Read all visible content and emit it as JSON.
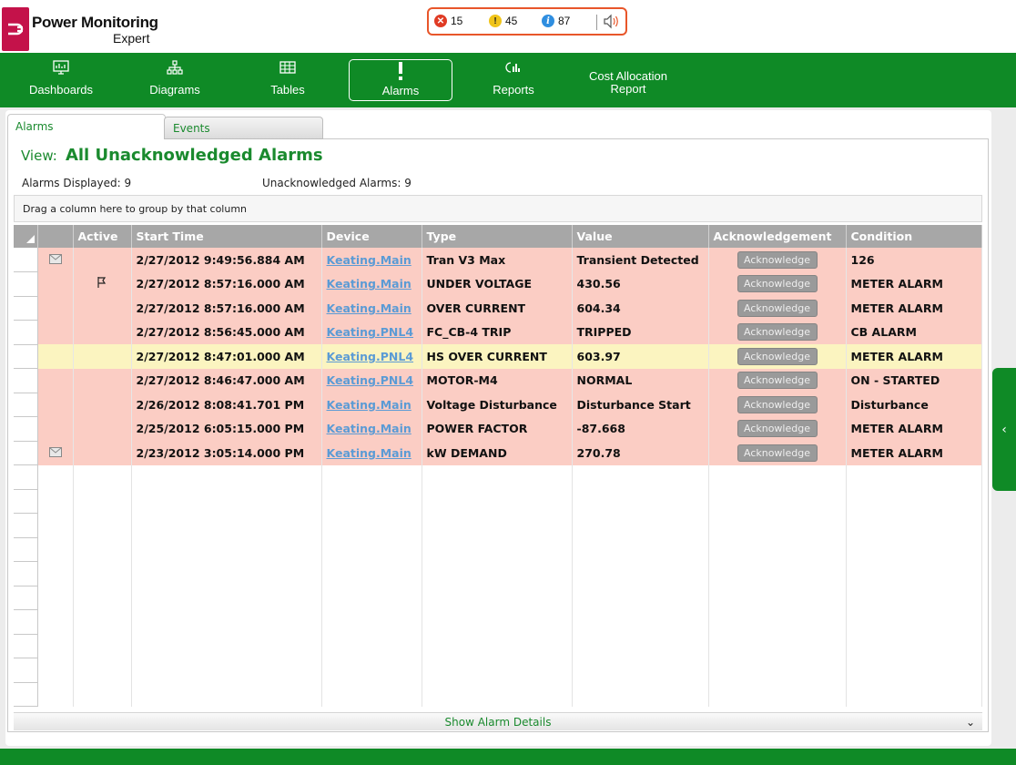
{
  "app": {
    "title": "Power Monitoring",
    "subtitle": "Expert"
  },
  "alarm_counts": {
    "critical": "15",
    "warning": "45",
    "info": "87"
  },
  "nav": {
    "items": [
      {
        "label": "Dashboards",
        "icon": "dashboard-icon"
      },
      {
        "label": "Diagrams",
        "icon": "diagram-icon"
      },
      {
        "label": "Tables",
        "icon": "table-icon"
      },
      {
        "label": "Alarms",
        "icon": "alarm-exclamation-icon",
        "active": true
      },
      {
        "label": "Reports",
        "icon": "reports-icon"
      },
      {
        "label_line1": "Cost Allocation",
        "label_line2": "Report"
      }
    ]
  },
  "tabs": {
    "alarms": "Alarms",
    "events": "Events"
  },
  "view": {
    "label": "View:",
    "name": "All Unacknowledged Alarms"
  },
  "stats": {
    "displayed": "Alarms Displayed:  9",
    "unacknowledged": "Unacknowledged Alarms:  9"
  },
  "group_bar": "Drag a column here to group by that column",
  "columns": [
    "Active",
    "Start Time",
    "Device",
    "Type",
    "Value",
    "Acknowledgement",
    "Condition"
  ],
  "rows": [
    {
      "icon": "envelope",
      "start": "2/27/2012 9:49:56.884 AM",
      "device": "Keating.Main",
      "type": "Tran V3 Max",
      "value": "Transient Detected",
      "ack": "Acknowledge",
      "condition": "126",
      "color": "red"
    },
    {
      "icon": "flag",
      "start": "2/27/2012 8:57:16.000 AM",
      "device": "Keating.Main",
      "type": "UNDER VOLTAGE",
      "value": "430.56",
      "ack": "Acknowledge",
      "condition": "METER ALARM",
      "color": "red"
    },
    {
      "icon": "",
      "start": "2/27/2012 8:57:16.000 AM",
      "device": "Keating.Main",
      "type": "OVER CURRENT",
      "value": "604.34",
      "ack": "Acknowledge",
      "condition": "METER ALARM",
      "color": "red"
    },
    {
      "icon": "",
      "start": "2/27/2012 8:56:45.000 AM",
      "device": "Keating.PNL4",
      "type": "FC_CB-4 TRIP",
      "value": "TRIPPED",
      "ack": "Acknowledge",
      "condition": "CB ALARM",
      "color": "red"
    },
    {
      "icon": "",
      "start": "2/27/2012 8:47:01.000 AM",
      "device": "Keating.PNL4",
      "type": "HS OVER CURRENT",
      "value": "603.97",
      "ack": "Acknowledge",
      "condition": "METER ALARM",
      "color": "yellow"
    },
    {
      "icon": "",
      "start": "2/27/2012 8:46:47.000 AM",
      "device": "Keating.PNL4",
      "type": "MOTOR-M4",
      "value": "NORMAL",
      "ack": "Acknowledge",
      "condition": "ON - STARTED",
      "color": "red"
    },
    {
      "icon": "",
      "start": "2/26/2012 8:08:41.701 PM",
      "device": "Keating.Main",
      "type": "Voltage Disturbance",
      "value": "Disturbance Start",
      "ack": "Acknowledge",
      "condition": "Disturbance",
      "color": "red"
    },
    {
      "icon": "",
      "start": "2/25/2012 6:05:15.000 PM",
      "device": "Keating.Main",
      "type": "POWER FACTOR",
      "value": "-87.668",
      "ack": "Acknowledge",
      "condition": "METER ALARM",
      "color": "red"
    },
    {
      "icon": "envelope",
      "start": "2/23/2012 3:05:14.000 PM",
      "device": "Keating.Main",
      "type": "kW DEMAND",
      "value": "270.78",
      "ack": "Acknowledge",
      "condition": "METER ALARM",
      "color": "red"
    }
  ],
  "empty_rows": 10,
  "show_details": "Show Alarm Details",
  "colors": {
    "brand_green": "#0f8a26",
    "logo_red": "#c4124a",
    "alarm_row": "#fbcdc4",
    "highlight_row": "#fbf4c0",
    "link_blue": "#5b9bd5"
  }
}
